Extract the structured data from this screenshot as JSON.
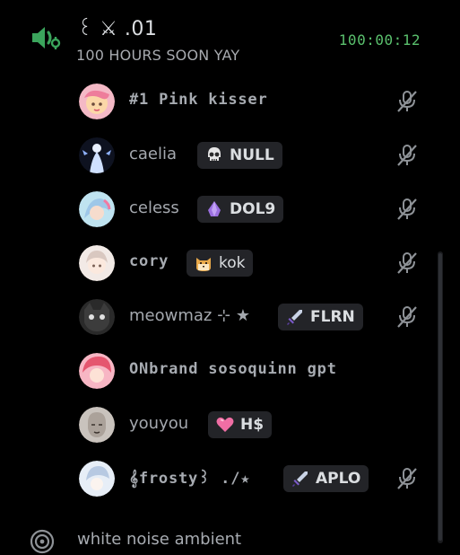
{
  "channel": {
    "name": "꒰ ⚔ .01",
    "status": "100 HOURS SOON YAY",
    "timer": "100:00:12"
  },
  "members": [
    {
      "name": "#1 Pink kisser",
      "tag": null,
      "muted": true
    },
    {
      "name": "caelia",
      "tag": {
        "emoji": "skull",
        "label": "NULL"
      },
      "muted": true
    },
    {
      "name": "celess",
      "tag": {
        "emoji": "purple-crystal",
        "label": "DOL9"
      },
      "muted": true
    },
    {
      "name": "cory",
      "tag": {
        "emoji": "cat-face",
        "label": "kok"
      },
      "muted": true
    },
    {
      "name": "meowmaz ⊹ ★",
      "tag": {
        "emoji": "sword",
        "label": "FLRN"
      },
      "muted": true
    },
    {
      "name": "ONbrand sosoquinn gpt",
      "tag": null,
      "muted": false
    },
    {
      "name": "youyou",
      "tag": {
        "emoji": "pink-heart",
        "label": "H$"
      },
      "muted": false
    },
    {
      "name": "𝄞frosty꒱ ./★",
      "tag": {
        "emoji": "sword",
        "label": "APLO"
      },
      "muted": true
    }
  ],
  "next_channel": {
    "name": "white noise ambient"
  },
  "colors": {
    "background": "#000000",
    "timer": "#5ac06d",
    "voice_icon": "#3ba55c",
    "tag_background": "#232428",
    "muted_icon": "#8e9297"
  }
}
